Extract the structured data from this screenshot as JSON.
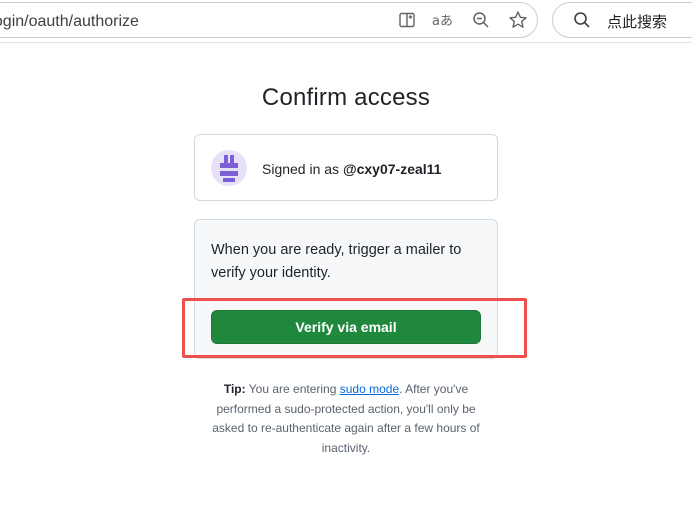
{
  "browser": {
    "url": "n/login/oauth/authorize",
    "search_text": "点此搜索",
    "icons": [
      "split-screen-icon",
      "read-aloud-icon",
      "zoom-out-icon",
      "favorite-star-icon",
      "search-icon"
    ]
  },
  "page": {
    "title": "Confirm access",
    "signed_in_prefix": "Signed in as",
    "username": "@cxy07-zeal11",
    "verify_message": "When you are ready, trigger a mailer to verify your identity.",
    "verify_button": "Verify via email",
    "tip": {
      "label": "Tip:",
      "before_link": "You are entering",
      "link": "sudo mode",
      "after_link": ". After you've performed a sudo-protected action, you'll only be asked to re-authenticate again after a few hours of inactivity."
    }
  },
  "colors": {
    "primary_button": "#1f883d",
    "highlight_border": "#ef4f4f",
    "link": "#0969da",
    "avatar_accent": "#7c5fd6"
  }
}
